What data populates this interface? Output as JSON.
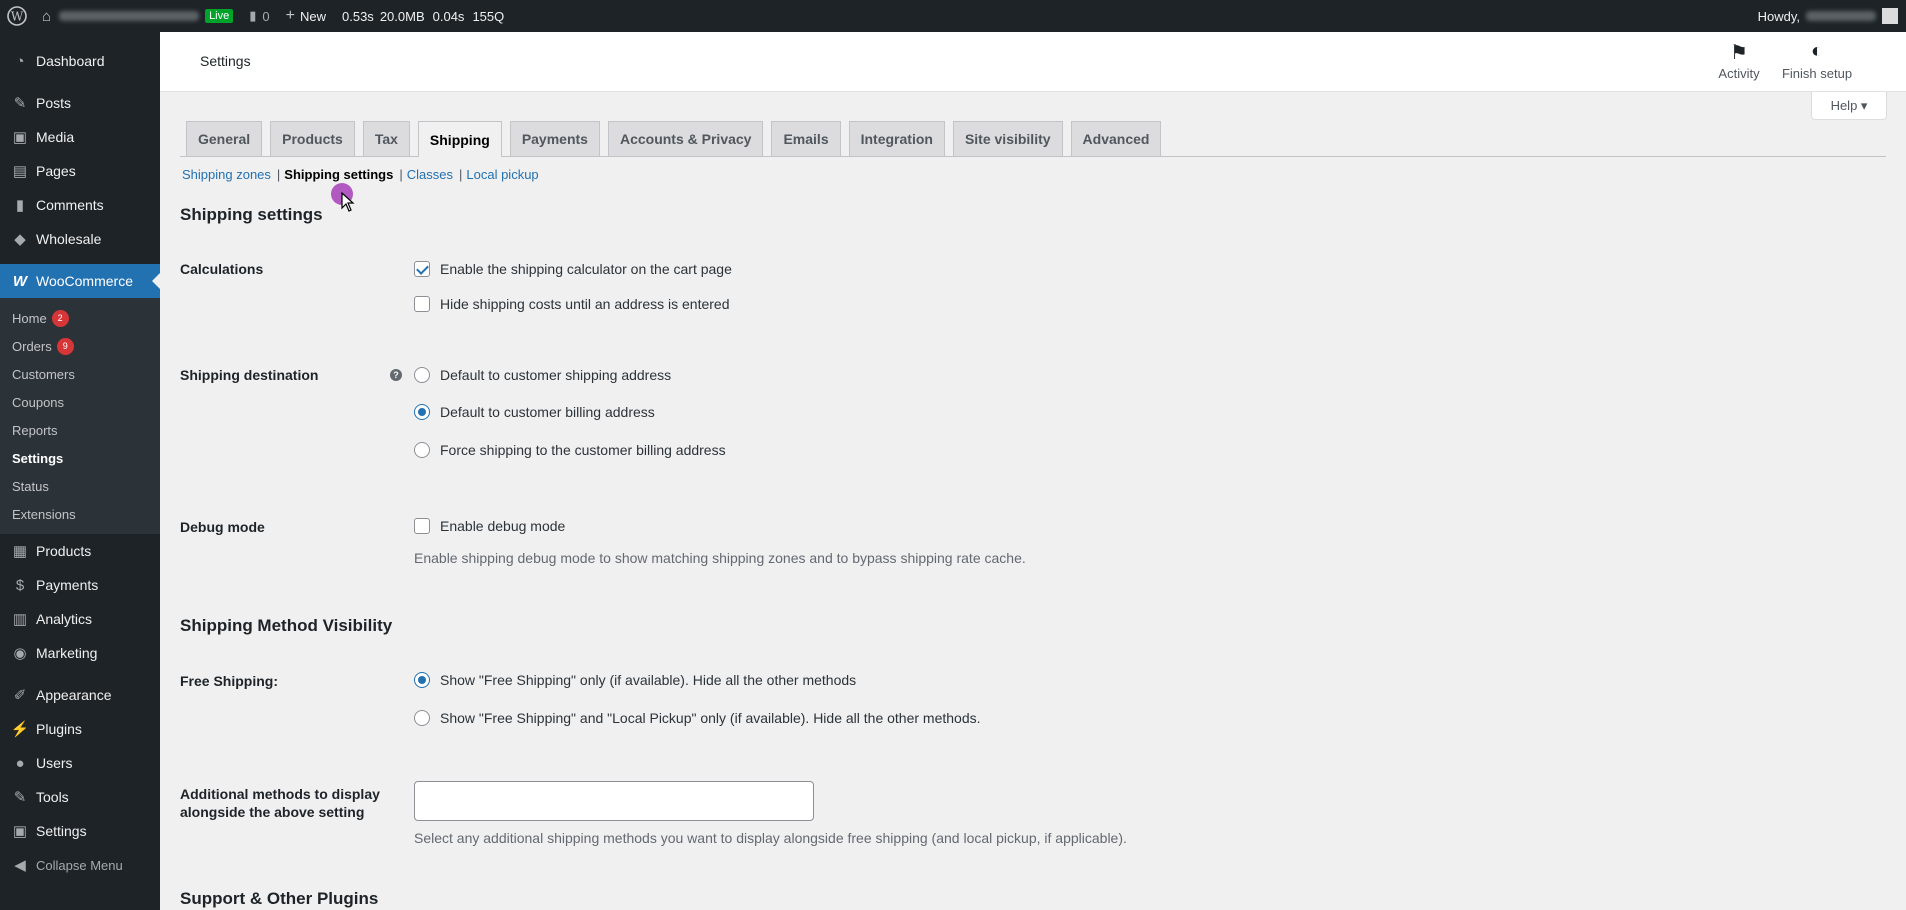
{
  "admin_bar": {
    "live_label": "Live",
    "comments_count": "0",
    "new_label": "New",
    "perf": [
      "0.53s",
      "20.0MB",
      "0.04s",
      "155Q"
    ],
    "howdy": "Howdy,"
  },
  "sidebar": {
    "items_top": [
      {
        "label": "Dashboard",
        "icon": "dashboard-icon"
      },
      {
        "label": "Posts",
        "icon": "pin-icon"
      },
      {
        "label": "Media",
        "icon": "media-icon"
      },
      {
        "label": "Pages",
        "icon": "pages-icon"
      },
      {
        "label": "Comments",
        "icon": "comment-icon"
      },
      {
        "label": "Wholesale",
        "icon": "wholesale-icon"
      },
      {
        "label": "WooCommerce",
        "icon": "woo-icon"
      }
    ],
    "woo_submenu": [
      {
        "label": "Home",
        "badge": "2"
      },
      {
        "label": "Orders",
        "badge": "9"
      },
      {
        "label": "Customers"
      },
      {
        "label": "Coupons"
      },
      {
        "label": "Reports"
      },
      {
        "label": "Settings"
      },
      {
        "label": "Status"
      },
      {
        "label": "Extensions"
      }
    ],
    "items_bottom": [
      {
        "label": "Products"
      },
      {
        "label": "Payments"
      },
      {
        "label": "Analytics"
      },
      {
        "label": "Marketing"
      },
      {
        "label": "Appearance"
      },
      {
        "label": "Plugins"
      },
      {
        "label": "Users"
      },
      {
        "label": "Tools"
      },
      {
        "label": "Settings"
      },
      {
        "label": "Collapse Menu"
      }
    ]
  },
  "header": {
    "title": "Settings",
    "activity": "Activity",
    "finish_setup": "Finish setup"
  },
  "help_label": "Help ▾",
  "tabs": [
    "General",
    "Products",
    "Tax",
    "Shipping",
    "Payments",
    "Accounts & Privacy",
    "Emails",
    "Integration",
    "Site visibility",
    "Advanced"
  ],
  "subnav": [
    "Shipping zones",
    "Shipping settings",
    "Classes",
    "Local pickup"
  ],
  "section_title": "Shipping settings",
  "calculations": {
    "label": "Calculations",
    "opt1": "Enable the shipping calculator on the cart page",
    "opt2": "Hide shipping costs until an address is entered"
  },
  "destination": {
    "label": "Shipping destination",
    "opt1": "Default to customer shipping address",
    "opt2": "Default to customer billing address",
    "opt3": "Force shipping to the customer billing address"
  },
  "debug": {
    "label": "Debug mode",
    "opt": "Enable debug mode",
    "desc": "Enable shipping debug mode to show matching shipping zones and to bypass shipping rate cache."
  },
  "visibility_title": "Shipping Method Visibility",
  "free_shipping": {
    "label": "Free Shipping:",
    "opt1": "Show \"Free Shipping\" only (if available). Hide all the other methods",
    "opt2": "Show \"Free Shipping\" and \"Local Pickup\" only (if available). Hide all the other methods."
  },
  "additional": {
    "label": "Additional methods to display alongside the above setting",
    "value": "",
    "desc": "Select any additional shipping methods you want to display alongside free shipping (and local pickup, if applicable)."
  },
  "support_title": "Support & Other Plugins"
}
